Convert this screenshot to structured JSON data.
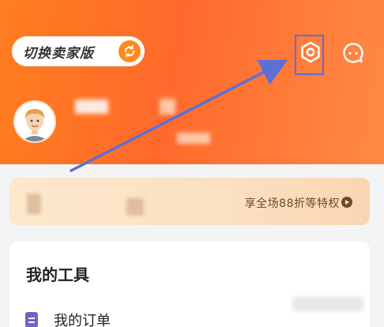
{
  "header": {
    "switch_label": "切换卖家版",
    "icons": {
      "switch": "refresh-icon",
      "settings": "settings-hexagon-icon",
      "message": "chat-bubble-icon"
    },
    "annotation_color": "#5b6fd6"
  },
  "vip_banner": {
    "privilege_text": "享全场88折等特权"
  },
  "tools": {
    "title": "我的工具",
    "items": [
      {
        "label": "我的订单",
        "icon": "order-list-icon"
      }
    ]
  }
}
